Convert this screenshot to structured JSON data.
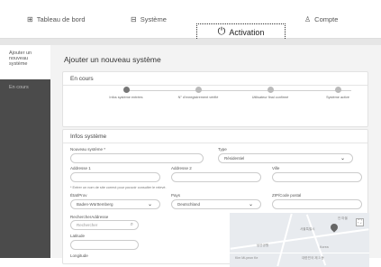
{
  "nav": {
    "tabs": [
      {
        "label": "Tableau de bord",
        "icon": "dashboard-icon"
      },
      {
        "label": "Système",
        "icon": "system-icon"
      },
      {
        "label": "Activation",
        "icon": "power-icon"
      },
      {
        "label": "Compte",
        "icon": "user-icon"
      }
    ]
  },
  "sidebar": {
    "active": "Ajouter un nouveau système",
    "items": [
      "En cours"
    ]
  },
  "page": {
    "title": "Ajouter un nouveau système"
  },
  "progress": {
    "title": "En cours",
    "steps": [
      {
        "label": "Infos système entrées",
        "done": true
      },
      {
        "label": "N° d'enregistrement vérifié",
        "done": false
      },
      {
        "label": "Utilisateur final confirmé",
        "done": false
      },
      {
        "label": "Système activé",
        "done": false
      }
    ]
  },
  "info": {
    "title": "Infos système",
    "new_system_label": "Nouveau système *",
    "type_label": "Type",
    "type_value": "Résidentiel",
    "address1_label": "Addresse 1",
    "address2_label": "Addresse 2",
    "city_label": "Ville",
    "note": "* Entrer un nom de site correct pour pouvoir consulter le relevé.",
    "state_label": "État/Prov",
    "state_value": "Baden-Württemberg",
    "country_label": "Pays",
    "country_value": "Deutschland",
    "zip_label": "ZIP/Code postal",
    "search_address_label": "RechercherAddresse",
    "search_placeholder": "Rechercher",
    "latitude_label": "Latitude",
    "longitude_label": "Longitude"
  },
  "map": {
    "labels": [
      "안 마을",
      "서울특별시",
      "남산공원",
      "Korea",
      "Kim Mi-yeon Ke",
      "대한민국 제 3 동"
    ]
  },
  "colors": {
    "sidebar": "#4b4b4b",
    "main_bg": "#f3f3f3",
    "accent": "#e6e6e6"
  }
}
